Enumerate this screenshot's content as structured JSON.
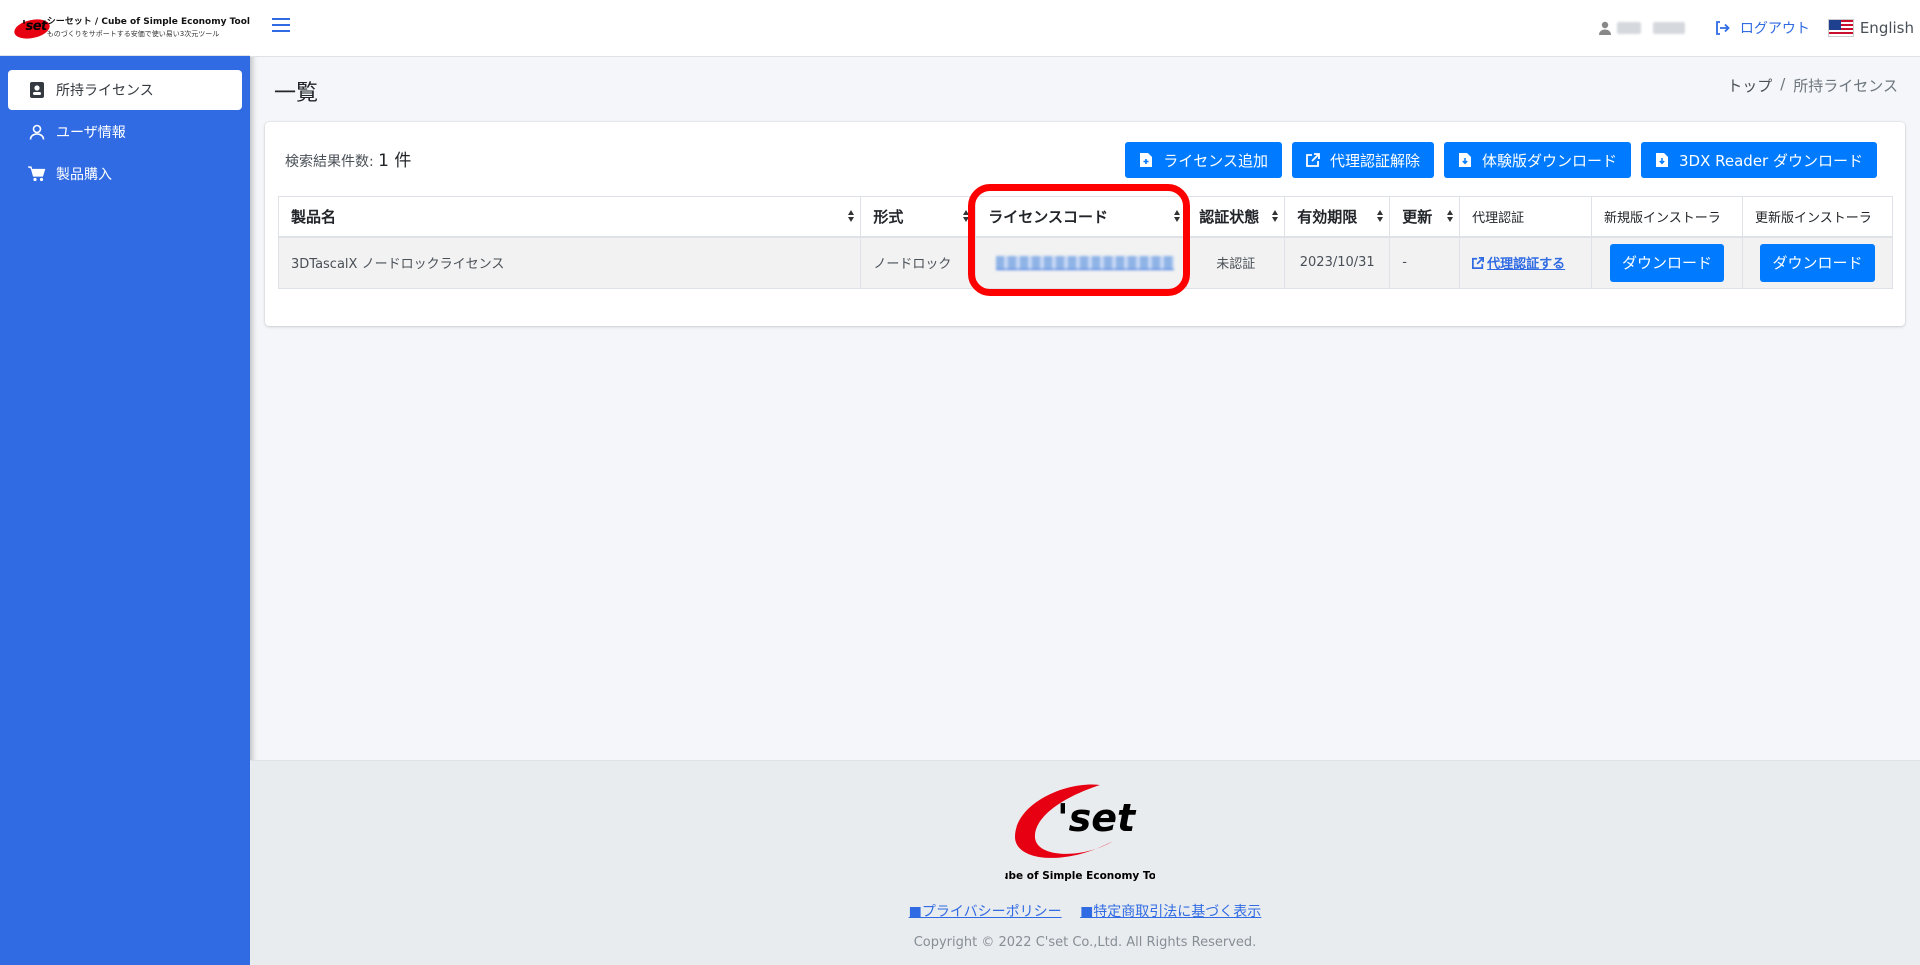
{
  "brand": {
    "logo_text": "'set",
    "line1": "シーセット / Cube of Simple Economy Tool",
    "line2": "ものづくりをサポートする安価で使い易い3次元ツール"
  },
  "sidebar": {
    "items": [
      {
        "label": "所持ライセンス",
        "icon": "id-badge-icon",
        "active": true
      },
      {
        "label": "ユーザ情報",
        "icon": "user-icon",
        "active": false
      },
      {
        "label": "製品購入",
        "icon": "cart-icon",
        "active": false
      }
    ]
  },
  "header": {
    "logout_label": "ログアウト",
    "language_label": "English"
  },
  "page": {
    "title": "一覧",
    "breadcrumb": [
      "トップ",
      "/",
      "所持ライセンス"
    ]
  },
  "results": {
    "label": "検索結果件数:",
    "count": "1 件"
  },
  "actions": [
    {
      "label": "ライセンス追加",
      "icon": "file-plus-icon"
    },
    {
      "label": "代理認証解除",
      "icon": "external-link-icon"
    },
    {
      "label": "体験版ダウンロード",
      "icon": "file-download-icon"
    },
    {
      "label": "3DX Reader ダウンロード",
      "icon": "file-download-icon"
    }
  ],
  "table": {
    "headers": [
      "製品名",
      "形式",
      "ライセンスコード",
      "認証状態",
      "有効期限",
      "更新",
      "代理認証",
      "新規版インストーラ",
      "更新版インストーラ"
    ],
    "rows": [
      {
        "product": "3DTascalX ノードロックライセンス",
        "type": "ノードロック",
        "status": "未認証",
        "expiry": "2023/10/31",
        "update": "-",
        "proxy_label": "代理認証する",
        "new_installer_label": "ダウンロード",
        "update_installer_label": "ダウンロード"
      }
    ]
  },
  "footer": {
    "logo_text": "'set",
    "logo_caption": "Cube of Simple Economy Tool",
    "links": [
      "■プライバシーポリシー",
      "■特定商取引法に基づく表示"
    ],
    "copyright": "Copyright © 2022 C'set Co.,Ltd. All Rights Reserved."
  },
  "colors": {
    "sidebar": "#306be3",
    "button": "#007bff",
    "highlight": "#ff0000",
    "logo_red": "#e60012"
  }
}
